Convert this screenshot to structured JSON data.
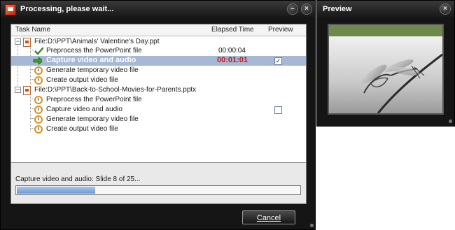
{
  "main_window": {
    "title": "Processing, please wait...",
    "columns": {
      "task": "Task Name",
      "elapsed": "Elapsed Time",
      "preview": "Preview"
    },
    "files": [
      {
        "label": "File:D:\\PPT\\Animals' Valentine's Day.ppt",
        "tasks": [
          {
            "label": "Preprocess the PowerPoint file",
            "time": "00:00:04",
            "status": "done"
          },
          {
            "label": "Capture video and audio",
            "time": "00:01:01",
            "status": "in-progress",
            "preview_checked": "✓"
          },
          {
            "label": "Generate temporary video file",
            "status": "pending"
          },
          {
            "label": "Create output video file",
            "status": "pending"
          }
        ]
      },
      {
        "label": "File:D:\\PPT\\Back-to-School-Movies-for-Parents.pptx",
        "tasks": [
          {
            "label": "Preprocess the PowerPoint file",
            "status": "pending"
          },
          {
            "label": "Capture video and audio",
            "status": "pending",
            "preview_checked": ""
          },
          {
            "label": "Generate temporary video file",
            "status": "pending"
          },
          {
            "label": "Create output video file",
            "status": "pending"
          }
        ]
      }
    ],
    "status_text": "Capture video and audio: Slide 8 of 25...",
    "progress": 0.28,
    "cancel_label": "Cancel"
  },
  "preview_window": {
    "title": "Preview"
  },
  "colors": {
    "selected_row": "#a6b8d6",
    "time_active": "#c2171c",
    "progress": "#6c98d4"
  }
}
